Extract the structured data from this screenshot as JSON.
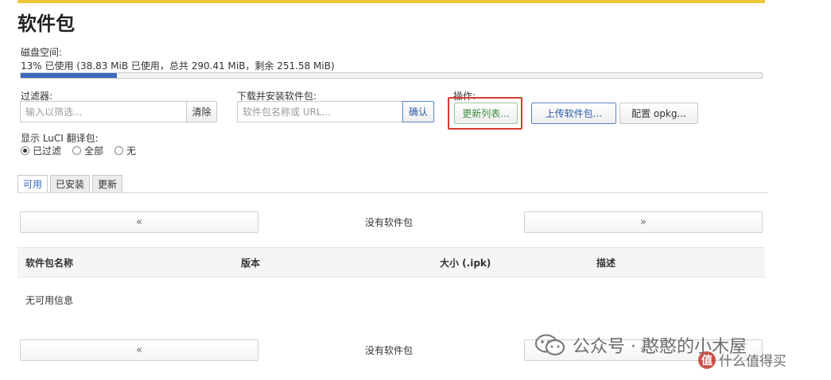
{
  "page": {
    "title": "软件包"
  },
  "disk": {
    "label": "磁盘空间:",
    "text": "13% 已使用 (38.83 MiB 已使用，总共 290.41 MiB，剩余 251.58 MiB)",
    "percent": 13
  },
  "filter": {
    "label": "过滤器:",
    "placeholder": "输入以筛选...",
    "clear_label": "清除"
  },
  "download": {
    "label": "下载并安装软件包:",
    "placeholder": "软件包名称或 URL...",
    "confirm_label": "确认"
  },
  "actions": {
    "label": "操作:",
    "update_label": "更新列表...",
    "upload_label": "上传软件包...",
    "config_label": "配置 opkg..."
  },
  "luci": {
    "label": "显示 LuCI 翻译包:",
    "options": [
      "已过滤",
      "全部",
      "无"
    ],
    "selected": "已过滤"
  },
  "tabs": [
    "可用",
    "已安装",
    "更新"
  ],
  "pager": {
    "prev": "«",
    "next": "»",
    "status": "没有软件包"
  },
  "table": {
    "headers": [
      "软件包名称",
      "版本",
      "大小 (.ipk)",
      "描述"
    ],
    "empty_text": "无可用信息"
  },
  "watermark": {
    "text": "公众号 · 憨憨的小木屋",
    "site_badge": "值",
    "site_text": "什么值得买"
  },
  "colors": {
    "accent_bar": "#f0c53a",
    "progress": "#3d6bbd",
    "highlight": "#d83a2f"
  }
}
